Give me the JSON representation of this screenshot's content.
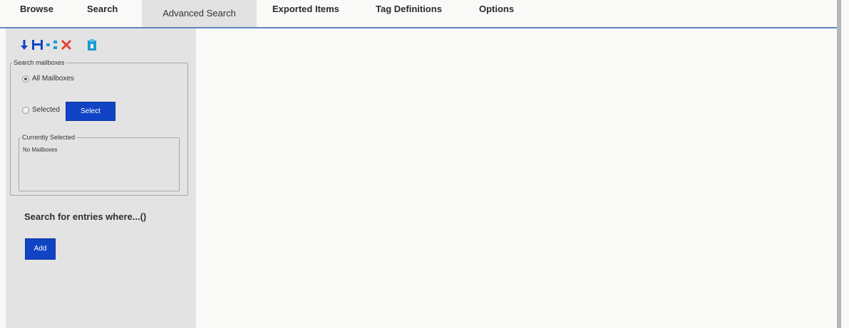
{
  "tabs": [
    {
      "label": "Browse"
    },
    {
      "label": "Search"
    },
    {
      "label": "Advanced Search",
      "active": true
    },
    {
      "label": "Exported Items"
    },
    {
      "label": "Tag Definitions"
    },
    {
      "label": "Options"
    }
  ],
  "toolbar": {
    "icons": [
      "download-arrow-icon",
      "save-icon",
      "share-icon",
      "delete-icon",
      "clipboard-icon"
    ]
  },
  "search_mailboxes": {
    "legend": "Search mailboxes",
    "all_label": "All Mailboxes",
    "selected_label": "Selected",
    "select_button": "Select",
    "selected_option": "All Mailboxes"
  },
  "currently_selected": {
    "legend": "Currently Selected",
    "value": "No Mailboxes"
  },
  "query": {
    "heading": "Search for entries where...()",
    "add_button": "Add"
  },
  "colors": {
    "accent_blue": "#1144c4",
    "tab_underline": "#5b86c5",
    "sidebar_bg": "#e3e3e3",
    "delete_red": "#e8412f"
  }
}
